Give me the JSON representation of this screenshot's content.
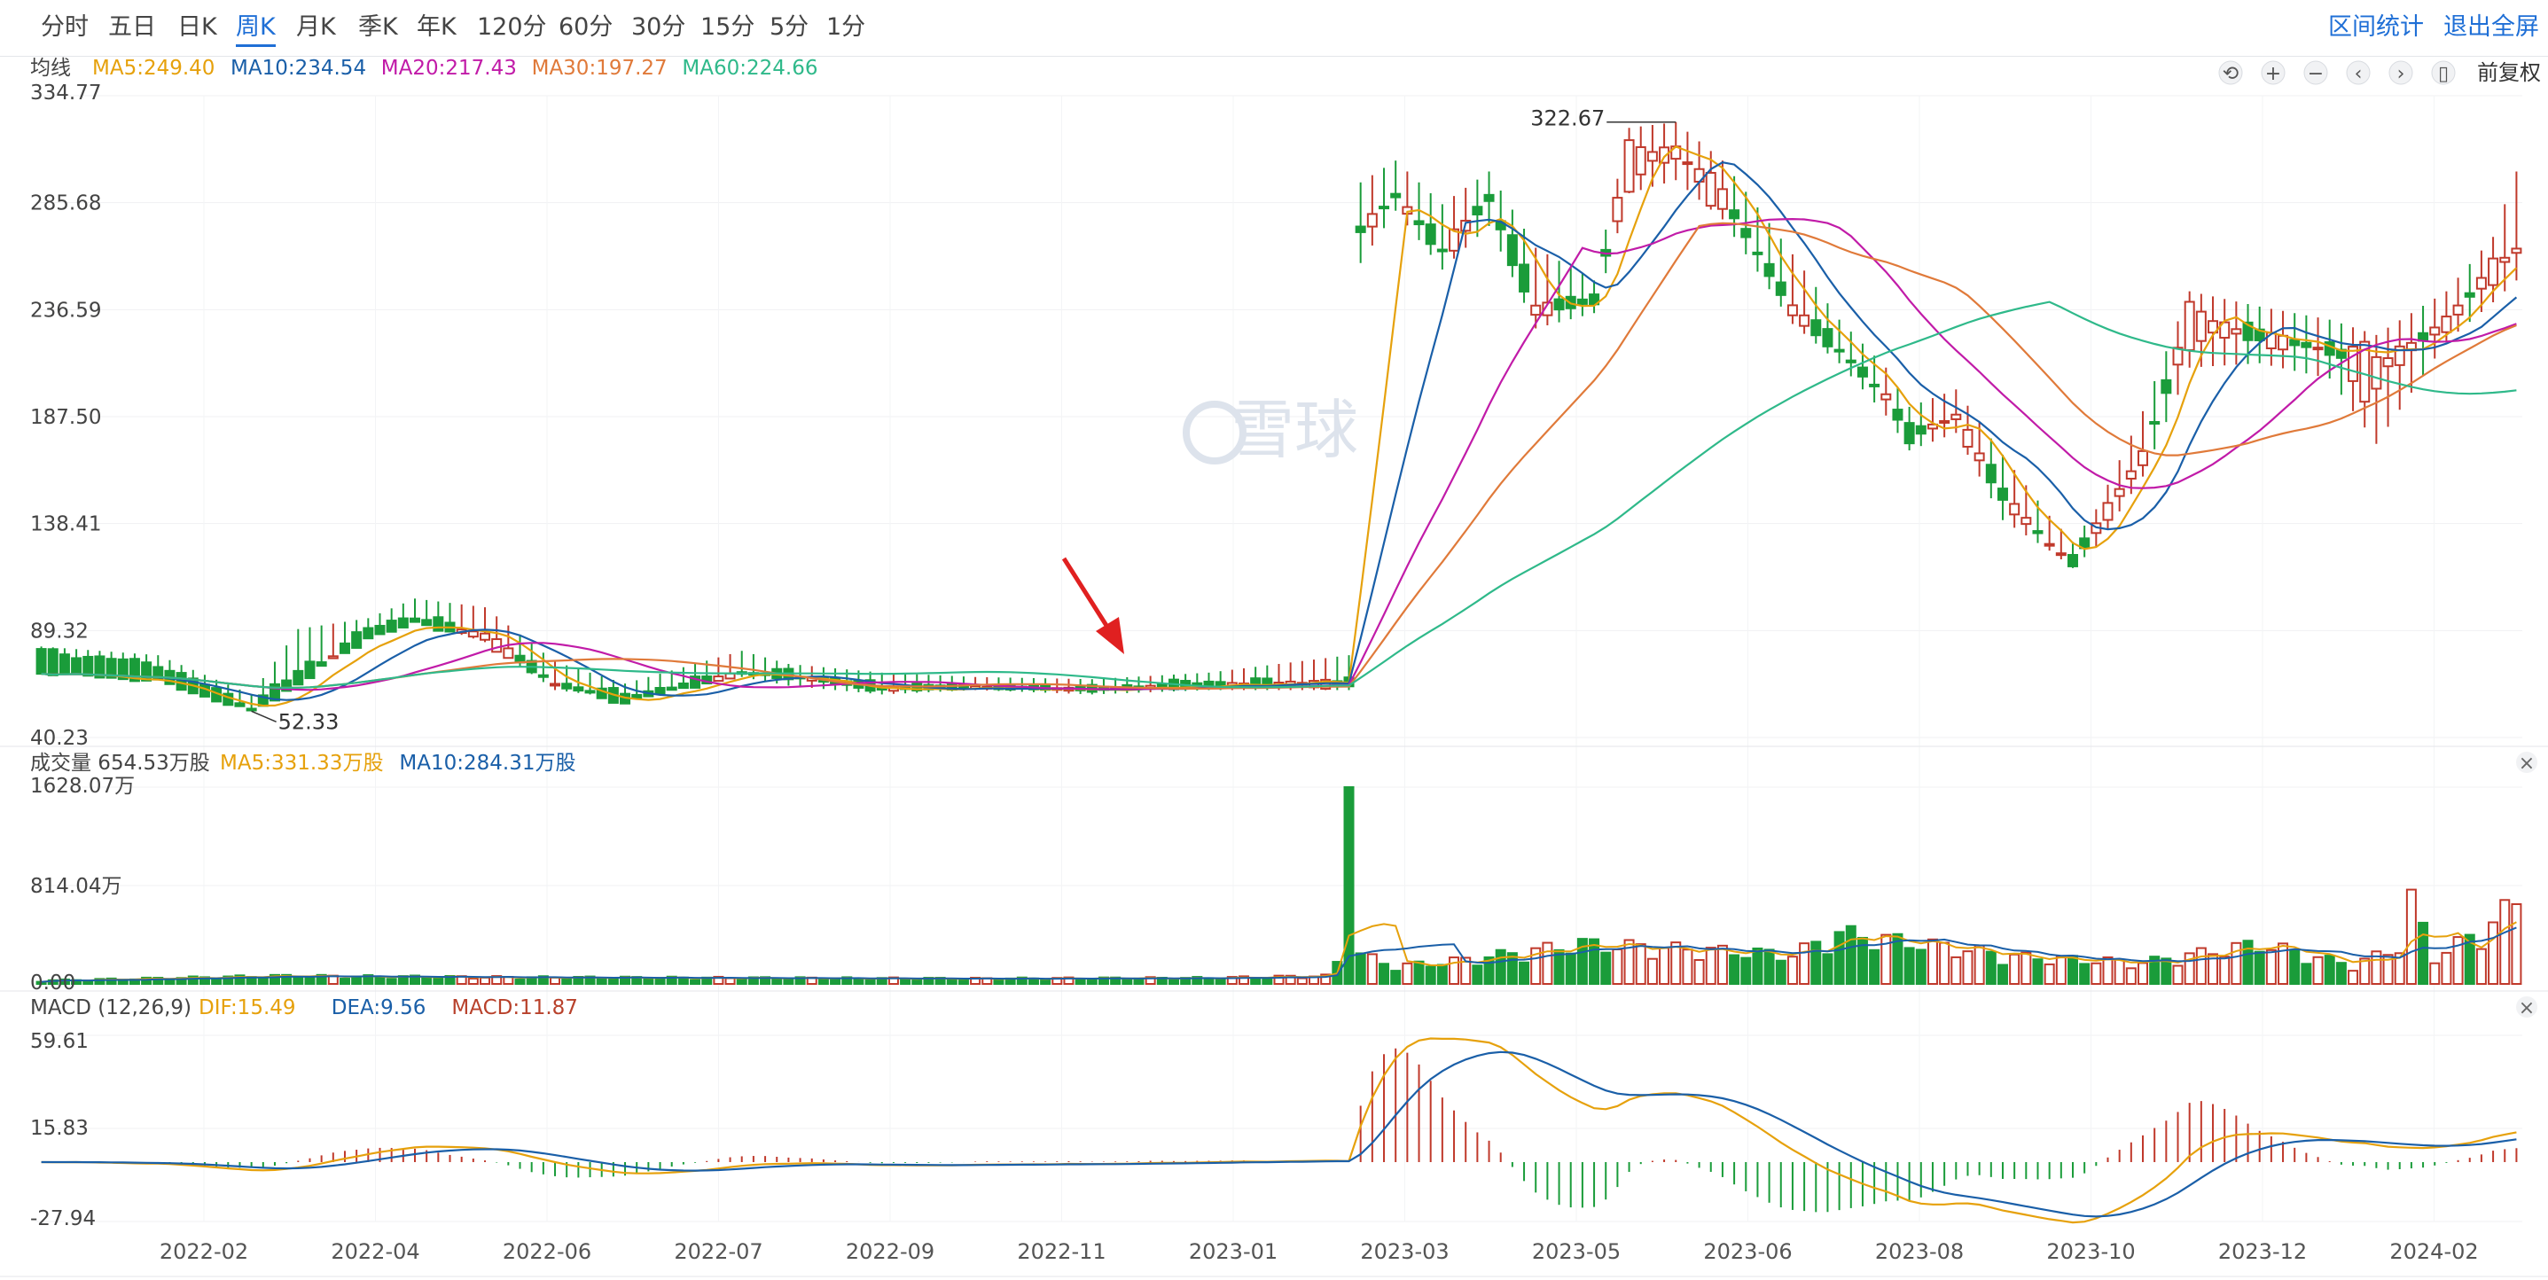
{
  "tabs": {
    "items": [
      "分时",
      "五日",
      "日K",
      "周K",
      "月K",
      "季K",
      "年K",
      "120分",
      "60分",
      "30分",
      "15分",
      "5分",
      "1分"
    ],
    "active": "周K",
    "right": [
      "区间统计",
      "退出全屏"
    ]
  },
  "price_panel": {
    "ma_label": "均线",
    "ma": [
      {
        "text": "MA5:249.40",
        "color": "#e6a10c"
      },
      {
        "text": "MA10:234.54",
        "color": "#1a5fa8"
      },
      {
        "text": "MA20:217.43",
        "color": "#c11ba8"
      },
      {
        "text": "MA30:197.27",
        "color": "#e07a3a"
      },
      {
        "text": "MA60:224.66",
        "color": "#2fb98a"
      }
    ],
    "y_ticks": [
      "334.77",
      "285.68",
      "236.59",
      "187.50",
      "138.41",
      "89.32",
      "40.23"
    ],
    "annotation_high": "322.67",
    "annotation_low": "52.33",
    "watermark": "雪球",
    "fuquan": "前复权"
  },
  "volume_panel": {
    "label": "成交量 654.53万股",
    "ma": [
      {
        "text": "MA5:331.33万股",
        "color": "#e6a10c"
      },
      {
        "text": "MA10:284.31万股",
        "color": "#1a5fa8"
      }
    ],
    "y_ticks": [
      "1628.07万",
      "814.04万",
      "0.00"
    ]
  },
  "macd_panel": {
    "label": "MACD (12,26,9)",
    "items": [
      {
        "text": "DIF:15.49",
        "color": "#e6a10c"
      },
      {
        "text": "DEA:9.56",
        "color": "#1a5fa8"
      },
      {
        "text": "MACD:11.87",
        "color": "#b8412b"
      }
    ],
    "y_ticks": [
      "59.61",
      "15.83",
      "-27.94"
    ]
  },
  "x_axis": {
    "labels": [
      "2022-02",
      "2022-04",
      "2022-06",
      "2022-07",
      "2022-09",
      "2022-11",
      "2023-01",
      "2023-03",
      "2023-05",
      "2023-06",
      "2023-08",
      "2023-10",
      "2023-12",
      "2024-02"
    ]
  },
  "colors": {
    "up": "#c0392b",
    "down": "#1a9c3a",
    "accent": "#1f6fd6"
  },
  "chart_data": {
    "type": "candlestick",
    "price_range": [
      40.23,
      334.77
    ],
    "volume_range": [
      0,
      1628.07
    ],
    "macd_range": [
      -27.94,
      59.61
    ],
    "anchors": [
      [
        0,
        80,
        82,
        75,
        70
      ],
      [
        10,
        74,
        78,
        72,
        66
      ],
      [
        18,
        55,
        60,
        52.33,
        52
      ],
      [
        22,
        70,
        90,
        68,
        65
      ],
      [
        28,
        90,
        95,
        88,
        86
      ],
      [
        32,
        97,
        104,
        94,
        92
      ],
      [
        38,
        85,
        100,
        84,
        88
      ],
      [
        44,
        66,
        75,
        62,
        64
      ],
      [
        50,
        60,
        65,
        58,
        56
      ],
      [
        60,
        70,
        80,
        68,
        70
      ],
      [
        64,
        70,
        74,
        64,
        68
      ],
      [
        72,
        64,
        70,
        60,
        62
      ],
      [
        80,
        64,
        68,
        62,
        63
      ],
      [
        90,
        63,
        67,
        60,
        62
      ],
      [
        100,
        66,
        70,
        62,
        64
      ],
      [
        112,
        64,
        78,
        62,
        66
      ],
      [
        113,
        275,
        295,
        258,
        272
      ],
      [
        116,
        290,
        305,
        282,
        288
      ],
      [
        120,
        262,
        285,
        255,
        265
      ],
      [
        124,
        290,
        300,
        275,
        286
      ],
      [
        128,
        240,
        265,
        228,
        235
      ],
      [
        133,
        242,
        250,
        235,
        240
      ],
      [
        136,
        298,
        320,
        290,
        310
      ],
      [
        140,
        305,
        322.67,
        296,
        312
      ],
      [
        144,
        286,
        305,
        278,
        290
      ],
      [
        150,
        240,
        262,
        230,
        235
      ],
      [
        154,
        218,
        232,
        212,
        218
      ],
      [
        158,
        200,
        210,
        188,
        195
      ],
      [
        160,
        180,
        192,
        172,
        178
      ],
      [
        164,
        187,
        200,
        180,
        188
      ],
      [
        168,
        150,
        170,
        140,
        152
      ],
      [
        172,
        130,
        142,
        126,
        128
      ],
      [
        174,
        122,
        130,
        118,
        120
      ],
      [
        176,
        135,
        145,
        128,
        138
      ],
      [
        180,
        168,
        190,
        160,
        170
      ],
      [
        184,
        225,
        245,
        210,
        236
      ],
      [
        190,
        225,
        238,
        212,
        224
      ],
      [
        196,
        218,
        232,
        205,
        218
      ],
      [
        200,
        200,
        225,
        175,
        215
      ],
      [
        206,
        232,
        245,
        222,
        230
      ],
      [
        210,
        248,
        270,
        240,
        260
      ],
      [
        212,
        262,
        300,
        250,
        265
      ]
    ],
    "vol_anchors": [
      [
        0,
        25
      ],
      [
        20,
        60
      ],
      [
        40,
        50
      ],
      [
        60,
        45
      ],
      [
        80,
        40
      ],
      [
        100,
        45
      ],
      [
        110,
        60
      ],
      [
        111,
        160
      ],
      [
        112,
        1628.07
      ],
      [
        113,
        220
      ],
      [
        116,
        130
      ],
      [
        122,
        180
      ],
      [
        132,
        300
      ],
      [
        150,
        220
      ],
      [
        154,
        380
      ],
      [
        170,
        200
      ],
      [
        180,
        160
      ],
      [
        190,
        300
      ],
      [
        198,
        140
      ],
      [
        202,
        280
      ],
      [
        203,
        620
      ],
      [
        205,
        200
      ],
      [
        210,
        450
      ],
      [
        212,
        620
      ],
      [
        213,
        300
      ]
    ],
    "ma_last": {
      "MA5": 249.4,
      "MA10": 234.54,
      "MA20": 217.43,
      "MA30": 197.27,
      "MA60": 224.66
    },
    "macd_last": {
      "DIF": 15.49,
      "DEA": 9.56,
      "MACD": 11.87
    }
  }
}
